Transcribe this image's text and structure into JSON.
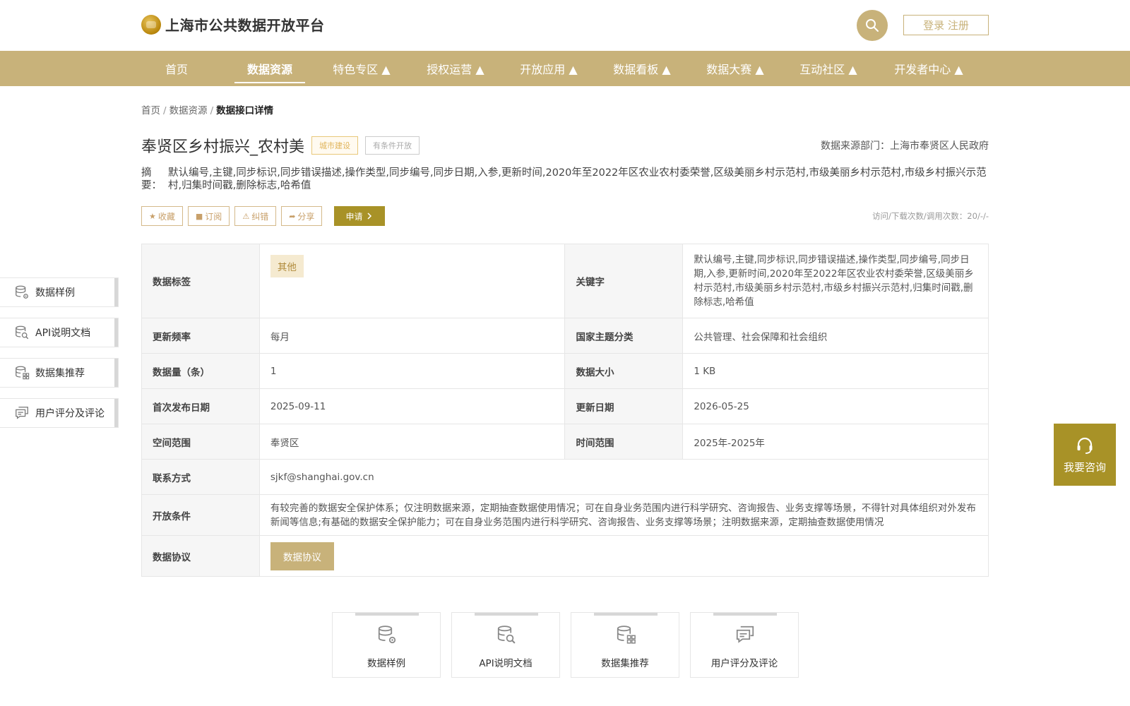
{
  "header": {
    "site_title": "上海市公共数据开放平台",
    "auth_label": "登录 注册",
    "search_icon": "search-icon"
  },
  "nav": {
    "items": [
      {
        "label": "首页"
      },
      {
        "label": "数据资源"
      },
      {
        "label": "特色专区 ▲"
      },
      {
        "label": "授权运营 ▲"
      },
      {
        "label": "开放应用 ▲"
      },
      {
        "label": "数据看板 ▲"
      },
      {
        "label": "数据大赛 ▲"
      },
      {
        "label": "互动社区 ▲"
      },
      {
        "label": "开发者中心 ▲"
      }
    ],
    "active_index": 1
  },
  "breadcrumb": {
    "items": [
      "首页",
      "数据资源"
    ],
    "current": "数据接口详情",
    "sep": "/"
  },
  "dataset": {
    "title": "奉贤区乡村振兴_农村美",
    "category_tag": "城市建设",
    "open_type_tag": "有条件开放",
    "source_label": "数据来源部门：上海市奉贤区人民政府",
    "summary_label": "摘 要：",
    "summary": "默认编号,主键,同步标识,同步错误描述,操作类型,同步编号,同步日期,入参,更新时间,2020年至2022年区农业农村委荣誉,区级美丽乡村示范村,市级美丽乡村示范村,市级乡村振兴示范村,归集时间戳,删除标志,哈希值"
  },
  "actions": {
    "favorite": "收藏",
    "subscribe": "订阅",
    "report": "纠错",
    "share": "分享",
    "apply": "申请",
    "visits": "访问/下载次数/调用次数：20/-/-"
  },
  "meta": {
    "tag_label": "数据标签",
    "tag_value": "其他",
    "keywords_label": "关键字",
    "keywords_value": "默认编号,主键,同步标识,同步错误描述,操作类型,同步编号,同步日期,入参,更新时间,2020年至2022年区农业农村委荣誉,区级美丽乡村示范村,市级美丽乡村示范村,市级乡村振兴示范村,归集时间戳,删除标志,哈希值",
    "freq_label": "更新频率",
    "freq_value": "每月",
    "theme_label": "国家主题分类",
    "theme_value": "公共管理、社会保障和社会组织",
    "count_label": "数据量（条）",
    "count_value": "1",
    "size_label": "数据大小",
    "size_value": "1 KB",
    "first_pub_label": "首次发布日期",
    "first_pub_value": "2025-09-11",
    "updated_label": "更新日期",
    "updated_value": "2026-05-25",
    "space_label": "空间范围",
    "space_value": "奉贤区",
    "time_label": "时间范围",
    "time_value": "2025年-2025年",
    "contact_label": "联系方式",
    "contact_value": "sjkf@shanghai.gov.cn",
    "cond_label": "开放条件",
    "cond_value": "有较完善的数据安全保护体系；仅注明数据来源，定期抽查数据使用情况；可在自身业务范围内进行科学研究、咨询报告、业务支撑等场景，不得针对具体组织对外发布新闻等信息;有基础的数据安全保护能力；可在自身业务范围内进行科学研究、咨询报告、业务支撑等场景；注明数据来源，定期抽查数据使用情况",
    "agreement_label": "数据协议",
    "agreement_button": "数据协议"
  },
  "side_tabs": [
    {
      "label": "数据样例",
      "icon": "database-gear-icon"
    },
    {
      "label": "API说明文档",
      "icon": "database-search-icon"
    },
    {
      "label": "数据集推荐",
      "icon": "database-grid-icon"
    },
    {
      "label": "用户评分及评论",
      "icon": "comment-icon"
    }
  ],
  "consult": {
    "label": "我要咨询",
    "icon": "headset-icon"
  },
  "colors": {
    "brand": "#c8b27a",
    "accent": "#a89227"
  }
}
